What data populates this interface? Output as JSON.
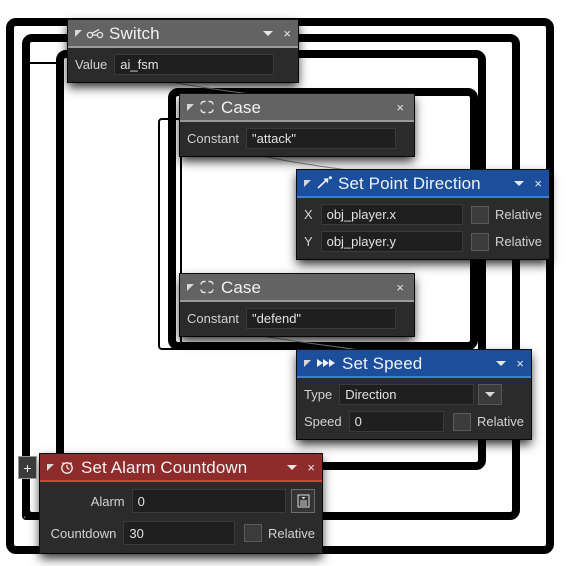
{
  "editor": {
    "name": "visual-script-node-editor",
    "background_color": "#ffffff",
    "frame_color": "#000000",
    "wire_color": "#8a8a8a",
    "add_button_label": "+"
  },
  "nodes": [
    {
      "id": "switch",
      "title": "Switch",
      "icon": "switch-icon",
      "header_color": "#636363",
      "accent_color": "#9a9a9a",
      "has_dropdown_caret": true,
      "close_label": "×",
      "fields": [
        {
          "label": "Value",
          "value": "ai_fsm",
          "type": "text"
        }
      ]
    },
    {
      "id": "case-attack",
      "title": "Case",
      "icon": "case-loop-icon",
      "header_color": "#636363",
      "accent_color": "#9a9a9a",
      "has_dropdown_caret": false,
      "close_label": "×",
      "fields": [
        {
          "label": "Constant",
          "value": "\"attack\"",
          "type": "text"
        }
      ]
    },
    {
      "id": "set-point-direction",
      "title": "Set Point Direction",
      "icon": "arrow-up-right-icon",
      "header_color": "#1b4f9c",
      "accent_color": "#3d7fd6",
      "has_dropdown_caret": true,
      "close_label": "×",
      "fields": [
        {
          "label": "X",
          "value": "obj_player.x",
          "type": "text",
          "checkbox_label": "Relative",
          "checked": false
        },
        {
          "label": "Y",
          "value": "obj_player.y",
          "type": "text",
          "checkbox_label": "Relative",
          "checked": false
        }
      ]
    },
    {
      "id": "case-defend",
      "title": "Case",
      "icon": "case-loop-icon",
      "header_color": "#636363",
      "accent_color": "#9a9a9a",
      "has_dropdown_caret": false,
      "close_label": "×",
      "fields": [
        {
          "label": "Constant",
          "value": "\"defend\"",
          "type": "text"
        }
      ]
    },
    {
      "id": "set-speed",
      "title": "Set Speed",
      "icon": "fast-forward-icon",
      "header_color": "#1b4f9c",
      "accent_color": "#3d7fd6",
      "has_dropdown_caret": true,
      "close_label": "×",
      "fields": [
        {
          "label": "Type",
          "value": "Direction",
          "type": "select",
          "options": [
            "Direction"
          ]
        },
        {
          "label": "Speed",
          "value": "0",
          "type": "text",
          "checkbox_label": "Relative",
          "checked": false
        }
      ]
    },
    {
      "id": "set-alarm-countdown",
      "title": "Set Alarm Countdown",
      "icon": "alarm-clock-icon",
      "header_color": "#8e2b2b",
      "accent_color": "#d4423c",
      "has_dropdown_caret": true,
      "close_label": "×",
      "fields": [
        {
          "label": "Alarm",
          "value": "0",
          "type": "text",
          "button_icon": "list-menu-icon"
        },
        {
          "label": "Countdown",
          "value": "30",
          "type": "text",
          "checkbox_label": "Relative",
          "checked": false
        }
      ]
    }
  ]
}
